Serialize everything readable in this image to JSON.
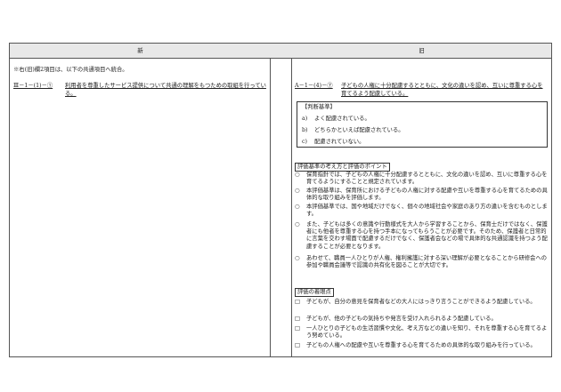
{
  "header": {
    "new": "新",
    "old": "旧"
  },
  "new_col": {
    "intro": "※右(旧)欄2項目は、以下の共通項目へ統合。",
    "item_code": "Ⅲ－1－(1)－①",
    "item_text": "利用者を尊重したサービス提供について共通の理解をもつための取組を行っている。"
  },
  "old_col": {
    "item_code": "A－1－(4)－⑦",
    "item_text": "子どもの人権に十分配慮するとともに、文化の違いを認め、互いに尊重する心を育てるよう配慮している。",
    "judgment_title": "【判断基準】",
    "judgments": [
      {
        "mark": "a)",
        "text": "よく配慮されている。"
      },
      {
        "mark": "b)",
        "text": "どちらかといえば配慮されている。"
      },
      {
        "mark": "c)",
        "text": "配慮されていない。"
      }
    ],
    "points_title": "評価基準の考え方と評価のポイント",
    "points": [
      "保育指針では、子どもの人権に十分配慮するとともに、文化の違いを認め、互いに尊重する心を育てるようにすることと規定されています。",
      "本評価基準は、保育所における子どもの人権に対する配慮や互いを尊重する心を育てるための具体的な取り組みを評価します。",
      "本評価基準では、国や地域だけでなく、個々の地域社会や家庭のあり方の違いを含むものとします。",
      "また、子どもは多くの意識や行動様式を大人から学習することから、保育士だけではなく、保護者にも他者を尊重する心を持つ手本になってもらうことが必要です。そのため、保護者と日常的に言葉を交わす場面で配慮するだけでなく、保護者会などの場で具体的な共通認識を持つよう配慮することが必要となります。",
      "あわせて、職員一人ひとりが人権、権利擁護に対する深い理解が必要となることから研修会への参加や職員会議等で認識の共有化を図ることが大切です。"
    ],
    "viewpoints_title": "評価の着眼点",
    "viewpoints": [
      "子どもが、自分の意見を保育者などの大人にはっきり言うことができるよう配慮している。",
      "子どもが、他の子どもの気持ちや発言を受け入れられるよう配慮している。",
      "一人ひとりの子どもの生活習慣や文化、考え方などの違いを知り、それを尊重する心を育てるよう努めている。",
      "子どもの人権への配慮や互いを尊重する心を育てるための具体的な取り組みを行っている。"
    ],
    "bullet_circle": "○",
    "bullet_square": "□"
  }
}
